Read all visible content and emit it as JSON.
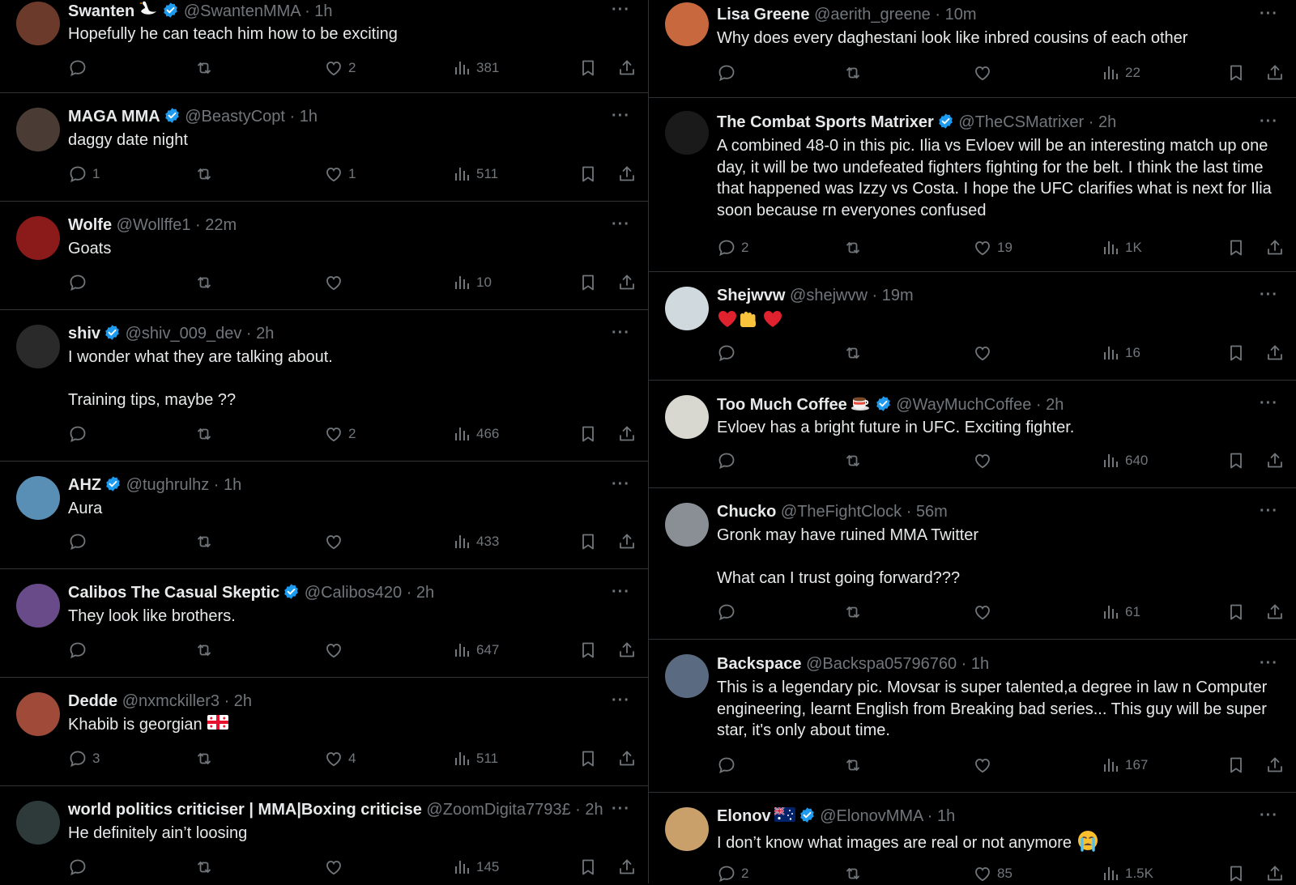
{
  "colors": {
    "background": "#000000",
    "text": "#e7e9ea",
    "muted": "#71767b",
    "verified": "#1d9bf0",
    "divider": "#2f3336",
    "heart_red": "#f91880"
  },
  "icons": {
    "reply": "reply-icon",
    "retweet": "retweet-icon",
    "like": "heart-icon",
    "views": "views-icon",
    "bookmark": "bookmark-icon",
    "share": "share-icon",
    "more": "more-icon",
    "verified": "verified-badge-icon"
  },
  "left_column": [
    {
      "name": "Swanten",
      "handle": "@SwantenMMA",
      "time": "1h",
      "verified": true,
      "name_emoji": "swan",
      "text": "Hopefully he can teach him how to be exciting",
      "replies": "",
      "likes": "2",
      "views": "381",
      "avatar_color": "#6b3a2a"
    },
    {
      "name": "MAGA MMA",
      "handle": "@BeastyCopt",
      "time": "1h",
      "verified": true,
      "text": "daggy date night",
      "replies": "1",
      "likes": "1",
      "views": "511",
      "avatar_color": "#4a3b35"
    },
    {
      "name": "Wolfe",
      "handle": "@Wollffe1",
      "time": "22m",
      "verified": false,
      "text": "Goats",
      "replies": "",
      "likes": "",
      "views": "10",
      "avatar_color": "#8b1a1a"
    },
    {
      "name": "shiv",
      "handle": "@shiv_009_dev",
      "time": "2h",
      "verified": true,
      "text": "I wonder what they are talking about.\n\nTraining tips, maybe ??",
      "replies": "",
      "likes": "2",
      "views": "466",
      "avatar_color": "#2a2a2a"
    },
    {
      "name": "AHZ",
      "handle": "@tughrulhz",
      "time": "1h",
      "verified": true,
      "text": "Aura",
      "replies": "",
      "likes": "",
      "views": "433",
      "avatar_color": "#5a8fb5"
    },
    {
      "name": "Calibos The Casual Skeptic",
      "handle": "@Calibos420",
      "time": "2h",
      "verified": true,
      "text": "They look like brothers.",
      "replies": "",
      "likes": "",
      "views": "647",
      "avatar_color": "#6a4b8a"
    },
    {
      "name": "Dedde",
      "handle": "@nxmckiller3",
      "time": "2h",
      "verified": false,
      "text": "Khabib is georgian",
      "text_emoji": "georgia-flag",
      "replies": "3",
      "likes": "4",
      "views": "511",
      "avatar_color": "#a04a3a"
    },
    {
      "name": "world politics criticiser | MMA|Boxing criticise",
      "handle": "@ZoomDigita7793£",
      "time": "2h",
      "verified": false,
      "text": "He definitely ain’t loosing",
      "replies": "",
      "likes": "",
      "views": "145",
      "avatar_color": "#2e3a3a"
    }
  ],
  "right_column": [
    {
      "name": "Lisa Greene",
      "handle": "@aerith_greene",
      "time": "10m",
      "verified": false,
      "text": "Why does every daghestani look like inbred cousins of each other",
      "replies": "",
      "likes": "",
      "views": "22",
      "avatar_color": "#c8683e"
    },
    {
      "name": "The Combat Sports Matrixer",
      "handle": "@TheCSMatrixer",
      "time": "2h",
      "verified": true,
      "text": "A combined 48-0 in this pic. Ilia vs Evloev will be an interesting match up one day, it will be two undefeated fighters fighting for the belt. I think the last time that happened was Izzy vs Costa. I hope the UFC clarifies what is next for Ilia soon because rn everyones confused",
      "replies": "2",
      "likes": "19",
      "views": "1K",
      "avatar_color": "#1a1a1a"
    },
    {
      "name": "Shejwvw",
      "handle": "@shejwvw",
      "time": "19m",
      "verified": false,
      "text": "",
      "text_emoji": "heart-hands-heart",
      "replies": "",
      "likes": "",
      "views": "16",
      "avatar_color": "#cfd9de"
    },
    {
      "name": "Too Much Coffee",
      "handle": "@WayMuchCoffee",
      "time": "2h",
      "verified": true,
      "name_emoji": "coffee",
      "text": "Evloev has a bright future in UFC. Exciting fighter.",
      "replies": "",
      "likes": "",
      "views": "640",
      "avatar_color": "#d8d8d0"
    },
    {
      "name": "Chucko",
      "handle": "@TheFightClock",
      "time": "56m",
      "verified": false,
      "text": "Gronk may have ruined MMA Twitter\n\nWhat can I trust going forward???",
      "replies": "",
      "likes": "",
      "views": "61",
      "avatar_color": "#8a8f95"
    },
    {
      "name": "Backspace",
      "handle": "@Backspa05796760",
      "time": "1h",
      "verified": false,
      "text": "This is a legendary pic. Movsar is super talented,a degree in law n Computer engineering, learnt English from Breaking bad series... This guy will be super star, it's only about time.",
      "replies": "",
      "likes": "",
      "views": "167",
      "avatar_color": "#5a6a80"
    },
    {
      "name": "Elonov",
      "handle": "@ElonovMMA",
      "time": "1h",
      "verified": true,
      "name_emoji": "australia-flag",
      "text": "I don’t know what images are real or not anymore",
      "text_emoji": "crying-face",
      "replies": "2",
      "likes": "85",
      "views": "1.5K",
      "avatar_color": "#c9a06a"
    }
  ]
}
